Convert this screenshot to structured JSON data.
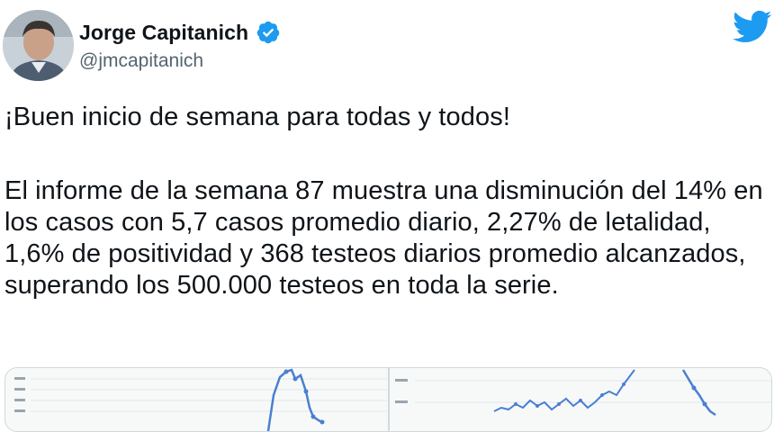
{
  "author": {
    "display_name": "Jorge Capitanich",
    "handle": "@jmcapitanich",
    "verified": true,
    "avatar_icon": "avatar-photo",
    "verified_icon": "verified-badge-icon",
    "brand_icon": "twitter-bird-icon"
  },
  "tweet": {
    "paragraphs": [
      "¡Buen inicio de semana para todas y todos!",
      "El informe de la semana 87 muestra una disminución del 14% en los casos con 5,7 casos promedio diario, 2,27% de letalidad, 1,6% de positividad y 368 testeos diarios promedio alcanzados, superando los 500.000 testeos en toda la serie."
    ]
  },
  "media": {
    "count": 2,
    "type": "chart-images"
  },
  "colors": {
    "text": "#0f1419",
    "secondary_text": "#536471",
    "twitter_blue": "#1d9bf0",
    "border": "#cfd9de",
    "chart_line": "#4a7fd1"
  }
}
